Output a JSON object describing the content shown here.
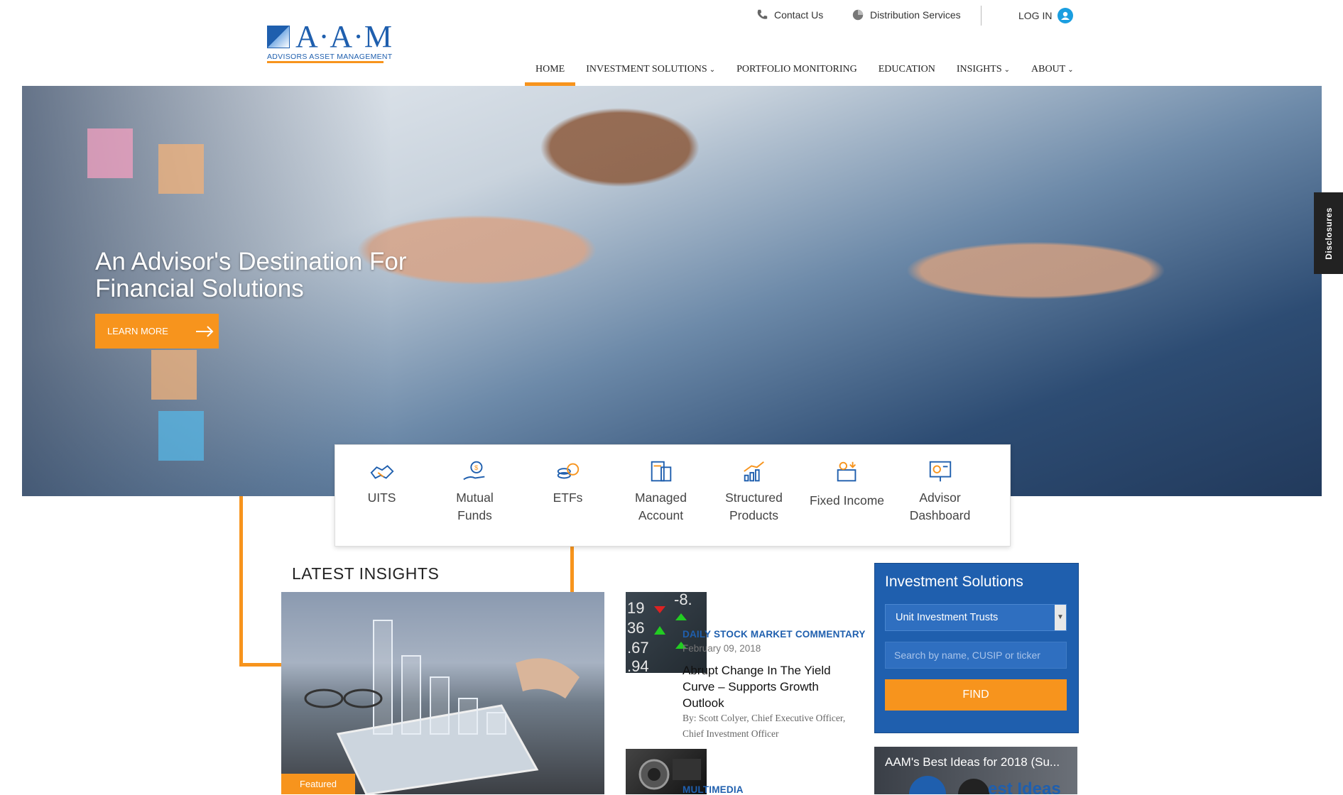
{
  "logo": {
    "text": "A·A·M",
    "subtitle": "ADVISORS ASSET MANAGEMENT"
  },
  "utility_nav": {
    "contact": "Contact Us",
    "distribution": "Distribution Services",
    "login": "LOG IN"
  },
  "main_nav": [
    {
      "label": "HOME",
      "active": true
    },
    {
      "label": "INVESTMENT SOLUTIONS",
      "dropdown": true
    },
    {
      "label": "PORTFOLIO MONITORING"
    },
    {
      "label": "EDUCATION"
    },
    {
      "label": "INSIGHTS",
      "dropdown": true
    },
    {
      "label": "ABOUT",
      "dropdown": true
    }
  ],
  "hero": {
    "title_line1": "An Advisor's Destination For",
    "title_line2": "Financial Solutions",
    "cta": "LEARN MORE"
  },
  "disclosures": "Disclosures",
  "tiles": [
    {
      "label": "UITS",
      "icon": "handshake-icon"
    },
    {
      "label": "Mutual Funds",
      "icon": "money-bag-hand-icon"
    },
    {
      "label": "ETFs",
      "icon": "coins-icon"
    },
    {
      "label": "Managed Account",
      "icon": "calculator-report-icon"
    },
    {
      "label": "Structured Products",
      "icon": "growth-chart-icon"
    },
    {
      "label": "Fixed Income",
      "icon": "income-box-icon"
    },
    {
      "label": "Advisor Dashboard",
      "icon": "presentation-board-icon"
    }
  ],
  "latest_insights": {
    "title": "LATEST INSIGHTS",
    "featured_tag": "Featured",
    "articles": [
      {
        "category": "DAILY STOCK MARKET COMMENTARY",
        "date": "February 09, 2018",
        "headline": "Abrupt Change In The Yield Curve – Supports Growth Outlook",
        "byline": "By: Scott Colyer, Chief Executive Officer, Chief Investment Officer"
      },
      {
        "category": "MULTIMEDIA"
      }
    ]
  },
  "investment_solutions": {
    "title": "Investment Solutions",
    "selected": "Unit Investment Trusts",
    "search_placeholder": "Search by name, CUSIP or ticker",
    "find": "FIND"
  },
  "video": {
    "title": "AAM's Best Ideas for 2018 (Su..."
  },
  "colors": {
    "brand_blue": "#1f5fae",
    "accent_orange": "#f7941d",
    "login_blue": "#1a9ee0"
  }
}
